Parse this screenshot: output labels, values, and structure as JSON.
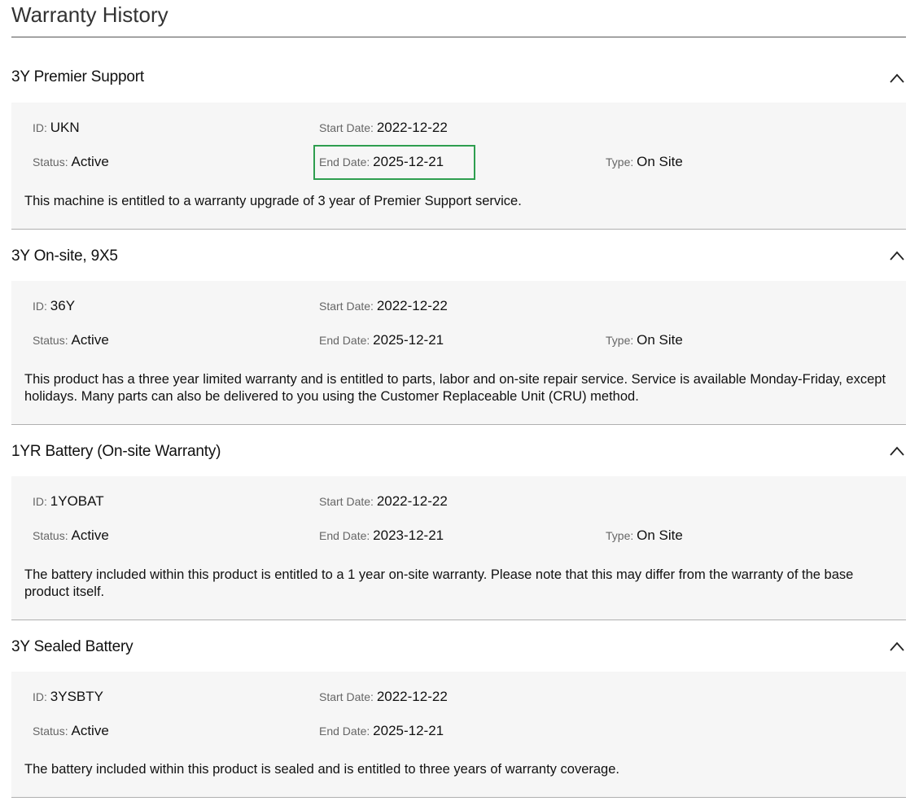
{
  "page": {
    "title": "Warranty History"
  },
  "labels": {
    "id": "ID",
    "start_date": "Start Date",
    "status": "Status",
    "end_date": "End Date",
    "type": "Type"
  },
  "warranties": [
    {
      "name": "3Y Premier Support",
      "expanded": true,
      "id": "UKN",
      "start_date": "2022-12-22",
      "status": "Active",
      "end_date": "2025-12-21",
      "type": "On Site",
      "end_date_highlighted": true,
      "highlight_color": "#2e9e4f",
      "description": "This machine is entitled to a warranty upgrade of 3 year of Premier Support service."
    },
    {
      "name": "3Y On-site, 9X5",
      "expanded": true,
      "id": "36Y",
      "start_date": "2022-12-22",
      "status": "Active",
      "end_date": "2025-12-21",
      "type": "On Site",
      "description": "This product has a three year limited warranty and is entitled to parts, labor and on-site repair service. Service is available Monday-Friday, except holidays. Many parts can also be delivered to you using the Customer Replaceable Unit (CRU) method."
    },
    {
      "name": "1YR Battery (On-site Warranty)",
      "expanded": true,
      "id": "1YOBAT",
      "start_date": "2022-12-22",
      "status": "Active",
      "end_date": "2023-12-21",
      "type": "On Site",
      "description": "The battery included within this product is entitled to a 1 year on-site warranty. Please note that this may differ from the warranty of the base product itself."
    },
    {
      "name": "3Y Sealed Battery",
      "expanded": true,
      "id": "3YSBTY",
      "start_date": "2022-12-22",
      "status": "Active",
      "end_date": "2025-12-21",
      "description": "The battery included within this product is sealed and is entitled to three years of warranty coverage."
    }
  ],
  "icons": {
    "collapse": "chevron-up-icon"
  }
}
